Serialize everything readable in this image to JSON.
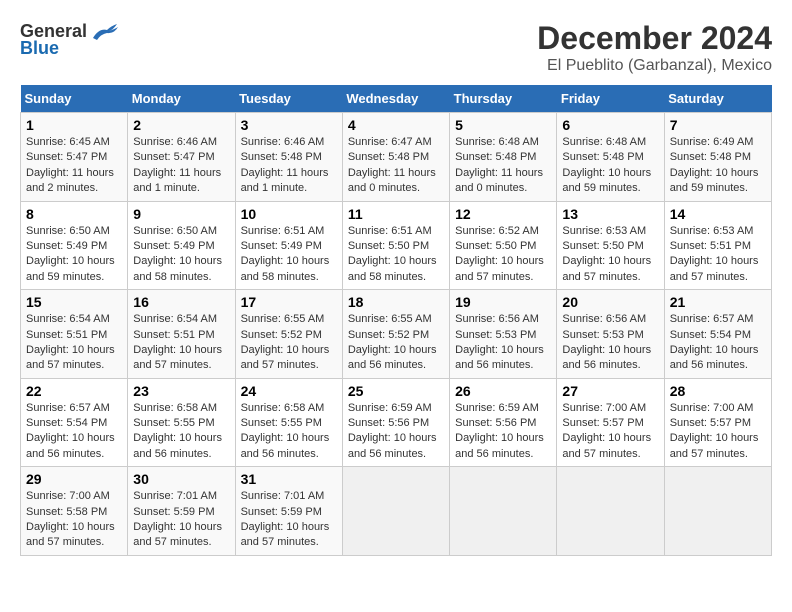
{
  "logo": {
    "general": "General",
    "blue": "Blue"
  },
  "title": "December 2024",
  "subtitle": "El Pueblito (Garbanzal), Mexico",
  "headers": [
    "Sunday",
    "Monday",
    "Tuesday",
    "Wednesday",
    "Thursday",
    "Friday",
    "Saturday"
  ],
  "weeks": [
    [
      {
        "day": "1",
        "info": "Sunrise: 6:45 AM\nSunset: 5:47 PM\nDaylight: 11 hours\nand 2 minutes."
      },
      {
        "day": "2",
        "info": "Sunrise: 6:46 AM\nSunset: 5:47 PM\nDaylight: 11 hours\nand 1 minute."
      },
      {
        "day": "3",
        "info": "Sunrise: 6:46 AM\nSunset: 5:48 PM\nDaylight: 11 hours\nand 1 minute."
      },
      {
        "day": "4",
        "info": "Sunrise: 6:47 AM\nSunset: 5:48 PM\nDaylight: 11 hours\nand 0 minutes."
      },
      {
        "day": "5",
        "info": "Sunrise: 6:48 AM\nSunset: 5:48 PM\nDaylight: 11 hours\nand 0 minutes."
      },
      {
        "day": "6",
        "info": "Sunrise: 6:48 AM\nSunset: 5:48 PM\nDaylight: 10 hours\nand 59 minutes."
      },
      {
        "day": "7",
        "info": "Sunrise: 6:49 AM\nSunset: 5:48 PM\nDaylight: 10 hours\nand 59 minutes."
      }
    ],
    [
      {
        "day": "8",
        "info": "Sunrise: 6:50 AM\nSunset: 5:49 PM\nDaylight: 10 hours\nand 59 minutes."
      },
      {
        "day": "9",
        "info": "Sunrise: 6:50 AM\nSunset: 5:49 PM\nDaylight: 10 hours\nand 58 minutes."
      },
      {
        "day": "10",
        "info": "Sunrise: 6:51 AM\nSunset: 5:49 PM\nDaylight: 10 hours\nand 58 minutes."
      },
      {
        "day": "11",
        "info": "Sunrise: 6:51 AM\nSunset: 5:50 PM\nDaylight: 10 hours\nand 58 minutes."
      },
      {
        "day": "12",
        "info": "Sunrise: 6:52 AM\nSunset: 5:50 PM\nDaylight: 10 hours\nand 57 minutes."
      },
      {
        "day": "13",
        "info": "Sunrise: 6:53 AM\nSunset: 5:50 PM\nDaylight: 10 hours\nand 57 minutes."
      },
      {
        "day": "14",
        "info": "Sunrise: 6:53 AM\nSunset: 5:51 PM\nDaylight: 10 hours\nand 57 minutes."
      }
    ],
    [
      {
        "day": "15",
        "info": "Sunrise: 6:54 AM\nSunset: 5:51 PM\nDaylight: 10 hours\nand 57 minutes."
      },
      {
        "day": "16",
        "info": "Sunrise: 6:54 AM\nSunset: 5:51 PM\nDaylight: 10 hours\nand 57 minutes."
      },
      {
        "day": "17",
        "info": "Sunrise: 6:55 AM\nSunset: 5:52 PM\nDaylight: 10 hours\nand 57 minutes."
      },
      {
        "day": "18",
        "info": "Sunrise: 6:55 AM\nSunset: 5:52 PM\nDaylight: 10 hours\nand 56 minutes."
      },
      {
        "day": "19",
        "info": "Sunrise: 6:56 AM\nSunset: 5:53 PM\nDaylight: 10 hours\nand 56 minutes."
      },
      {
        "day": "20",
        "info": "Sunrise: 6:56 AM\nSunset: 5:53 PM\nDaylight: 10 hours\nand 56 minutes."
      },
      {
        "day": "21",
        "info": "Sunrise: 6:57 AM\nSunset: 5:54 PM\nDaylight: 10 hours\nand 56 minutes."
      }
    ],
    [
      {
        "day": "22",
        "info": "Sunrise: 6:57 AM\nSunset: 5:54 PM\nDaylight: 10 hours\nand 56 minutes."
      },
      {
        "day": "23",
        "info": "Sunrise: 6:58 AM\nSunset: 5:55 PM\nDaylight: 10 hours\nand 56 minutes."
      },
      {
        "day": "24",
        "info": "Sunrise: 6:58 AM\nSunset: 5:55 PM\nDaylight: 10 hours\nand 56 minutes."
      },
      {
        "day": "25",
        "info": "Sunrise: 6:59 AM\nSunset: 5:56 PM\nDaylight: 10 hours\nand 56 minutes."
      },
      {
        "day": "26",
        "info": "Sunrise: 6:59 AM\nSunset: 5:56 PM\nDaylight: 10 hours\nand 56 minutes."
      },
      {
        "day": "27",
        "info": "Sunrise: 7:00 AM\nSunset: 5:57 PM\nDaylight: 10 hours\nand 57 minutes."
      },
      {
        "day": "28",
        "info": "Sunrise: 7:00 AM\nSunset: 5:57 PM\nDaylight: 10 hours\nand 57 minutes."
      }
    ],
    [
      {
        "day": "29",
        "info": "Sunrise: 7:00 AM\nSunset: 5:58 PM\nDaylight: 10 hours\nand 57 minutes."
      },
      {
        "day": "30",
        "info": "Sunrise: 7:01 AM\nSunset: 5:59 PM\nDaylight: 10 hours\nand 57 minutes."
      },
      {
        "day": "31",
        "info": "Sunrise: 7:01 AM\nSunset: 5:59 PM\nDaylight: 10 hours\nand 57 minutes."
      },
      null,
      null,
      null,
      null
    ]
  ]
}
